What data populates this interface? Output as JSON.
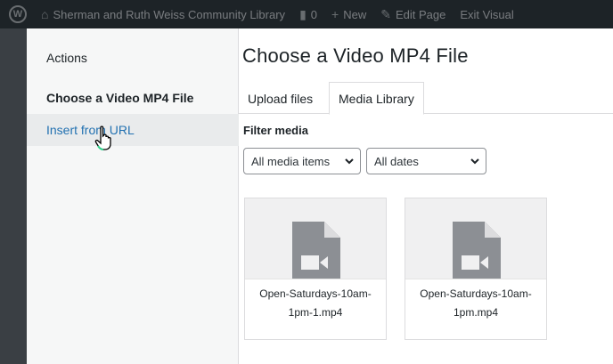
{
  "admin_bar": {
    "site_name": "Sherman and Ruth Weiss Community Library",
    "comments_count": "0",
    "new_label": "New",
    "edit_page_label": "Edit Page",
    "exit_visual_label": "Exit Visual"
  },
  "menu": {
    "heading": "Actions",
    "items": [
      {
        "label": "Choose a Video MP4 File"
      },
      {
        "label": "Insert from URL"
      }
    ]
  },
  "frame": {
    "title": "Choose a Video MP4 File"
  },
  "tabs": [
    {
      "label": "Upload files"
    },
    {
      "label": "Media Library"
    }
  ],
  "filters": {
    "label": "Filter media",
    "type_value": "All media items",
    "date_value": "All dates"
  },
  "attachments": [
    {
      "filename": "Open-Saturdays-10am-1pm-1.mp4",
      "icon": "video-file-icon"
    },
    {
      "filename": "Open-Saturdays-10am-1pm.mp4",
      "icon": "video-file-icon"
    }
  ],
  "colors": {
    "admin_bar_bg": "#1d2327",
    "link": "#2271b1",
    "menu_bg": "#f6f7f7"
  }
}
